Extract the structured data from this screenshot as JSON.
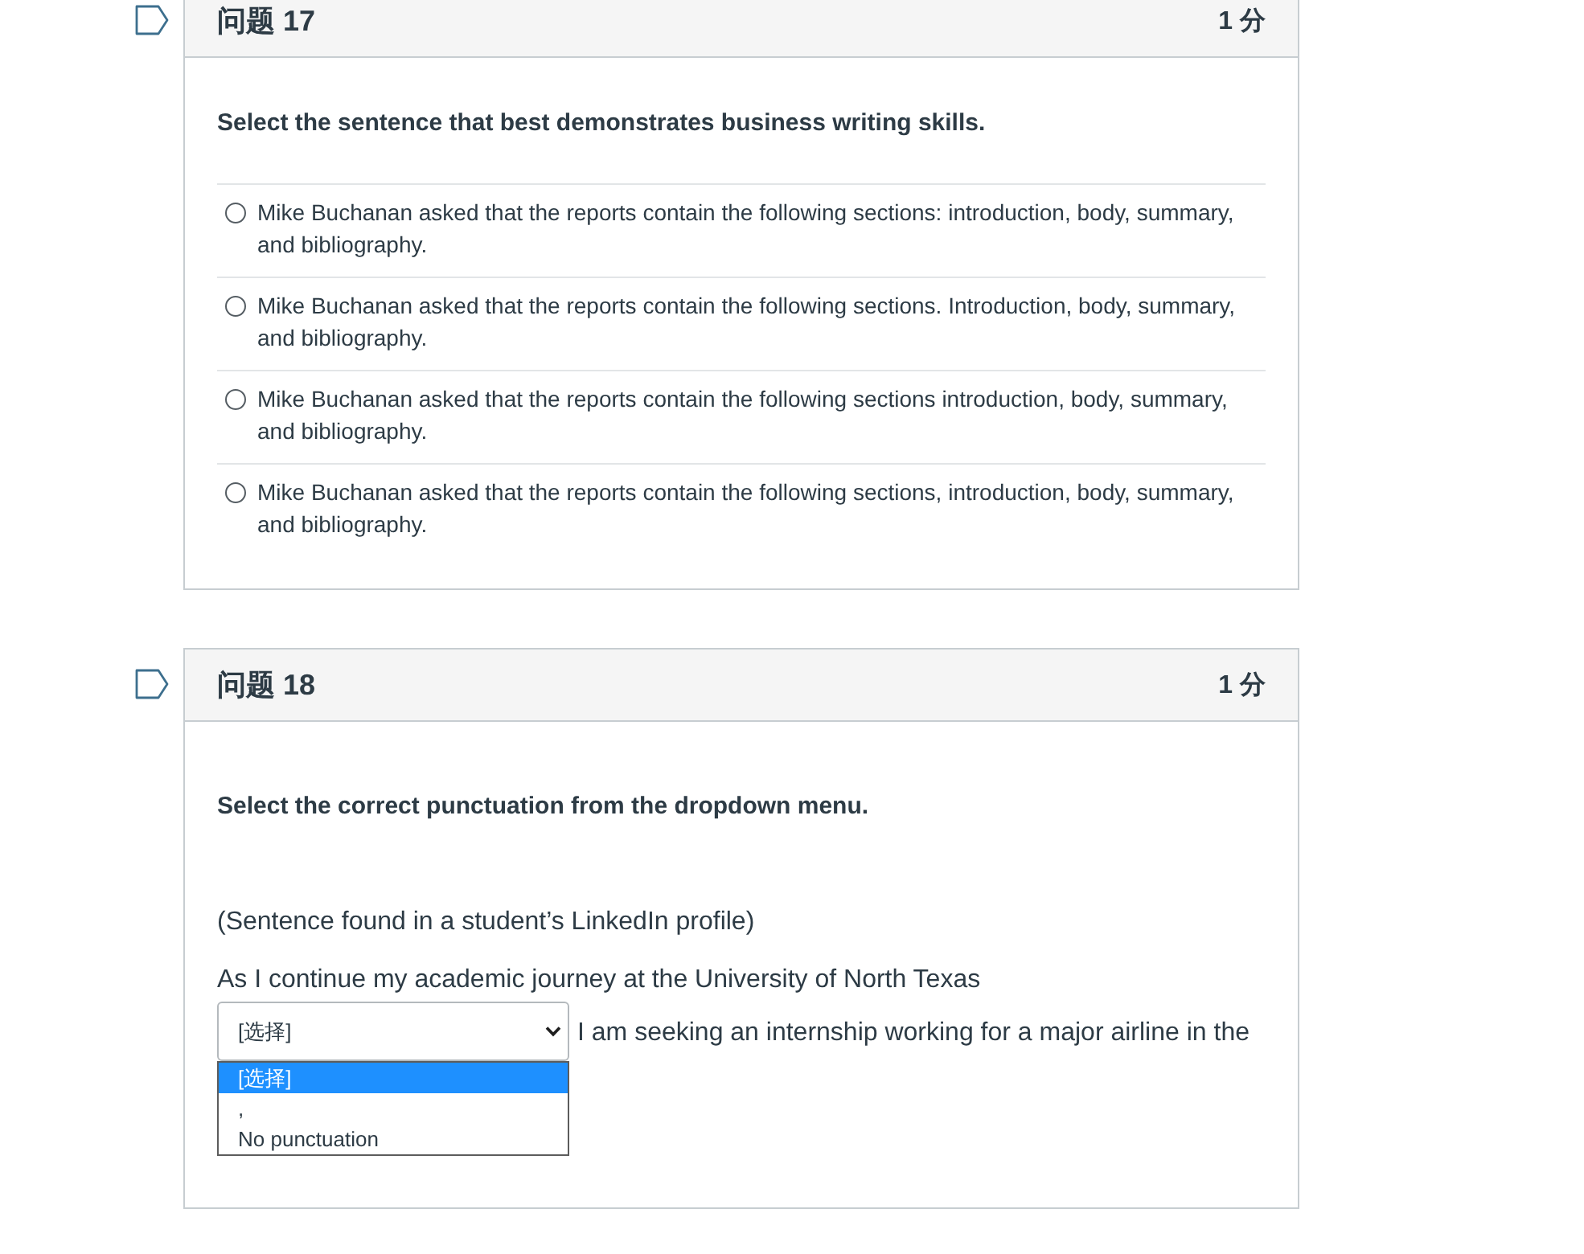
{
  "questions": [
    {
      "kind": "multiple_choice",
      "title": "问题 17",
      "points": "1 分",
      "prompt": "Select the sentence that best demonstrates business writing skills.",
      "answers": [
        {
          "text": "Mike Buchanan asked that the reports contain the following sections: introduction, body, summary, and bibliography.",
          "selected": false
        },
        {
          "text": "Mike Buchanan asked that the reports contain the following sections. Introduction, body, summary, and bibliography.",
          "selected": false
        },
        {
          "text": "Mike Buchanan asked that the reports contain the following sections introduction, body, summary, and bibliography.",
          "selected": false
        },
        {
          "text": "Mike Buchanan asked that the reports contain the following sections, introduction, body, summary, and bibliography.",
          "selected": false
        }
      ]
    },
    {
      "kind": "dropdown",
      "title": "问题 18",
      "points": "1 分",
      "prompt": "Select the correct punctuation from the dropdown menu.",
      "context": "(Sentence found in a student’s LinkedIn profile)",
      "sentence_before": "As I continue my academic journey at the University of North Texas",
      "dropdown": {
        "value": "[选择]",
        "expanded": true,
        "options": [
          {
            "label": "[选择]",
            "selected": true
          },
          {
            "label": ",",
            "selected": false
          },
          {
            "label": "No punctuation",
            "selected": false
          }
        ]
      },
      "sentence_after": "I am seeking an internship working for a major airline in the"
    }
  ]
}
